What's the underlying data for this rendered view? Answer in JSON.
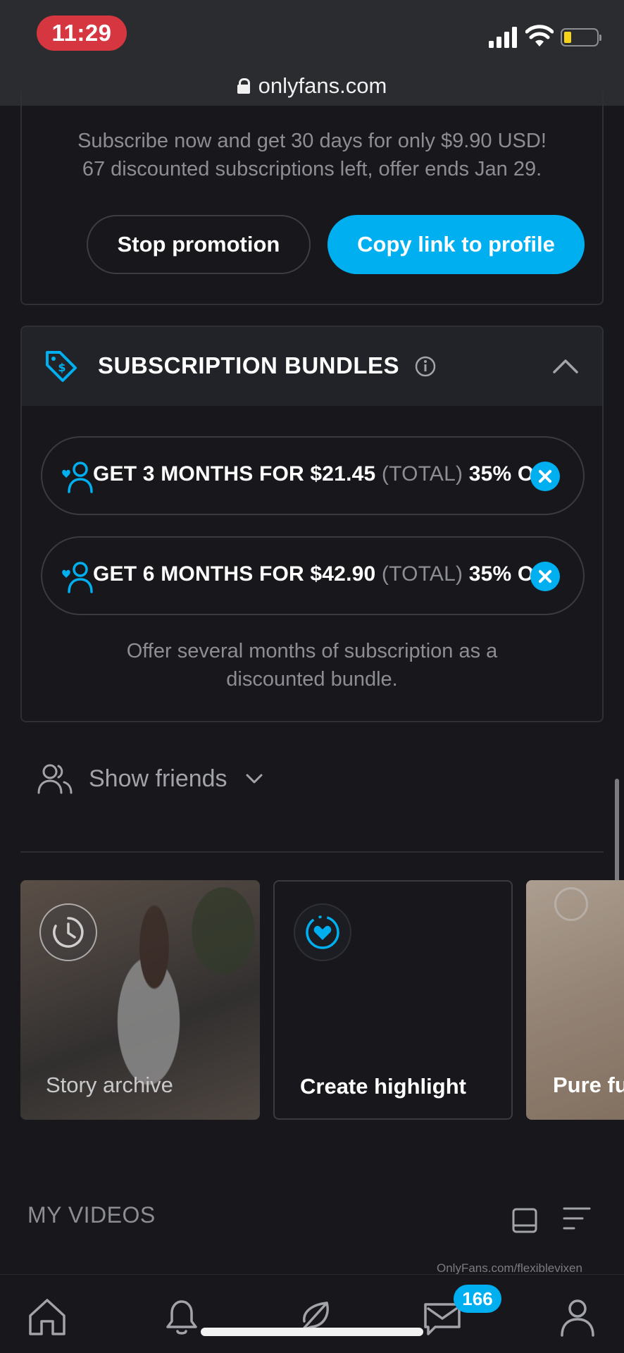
{
  "status_bar": {
    "time": "11:29",
    "url": "onlyfans.com",
    "battery_color": "#f4d31a"
  },
  "promotion": {
    "line1": "Subscribe now and get 30 days for only $9.90 USD!",
    "line2": "67 discounted subscriptions left, offer ends Jan 29.",
    "stop_label": "Stop promotion",
    "copy_label": "Copy link to profile"
  },
  "bundles": {
    "title": "SUBSCRIPTION BUNDLES",
    "items": [
      {
        "main": "GET 3 MONTHS FOR $21.45 ",
        "total": "(TOTAL)",
        "discount": " 35% OFF"
      },
      {
        "main": "GET 6 MONTHS FOR $42.90 ",
        "total": "(TOTAL)",
        "discount": " 35% OFF"
      }
    ],
    "note_line1": "Offer several months of subscription as a",
    "note_line2": "discounted bundle."
  },
  "friends": {
    "label": "Show friends"
  },
  "highlights": [
    {
      "label": "Story archive",
      "icon": "clock-icon"
    },
    {
      "label": "Create highlight",
      "icon": "heart-ring-icon"
    },
    {
      "label": "Pure fu"
    }
  ],
  "videos": {
    "title": "MY VIDEOS"
  },
  "watermark": "OnlyFans.com/flexiblevixen",
  "bottom_nav": {
    "items": [
      "home-icon",
      "bell-icon",
      "feather-icon",
      "message-icon",
      "profile-icon"
    ],
    "messages_badge": "166"
  },
  "colors": {
    "accent": "#00aff0",
    "background": "#17171c",
    "time_pill": "#d5363f"
  }
}
